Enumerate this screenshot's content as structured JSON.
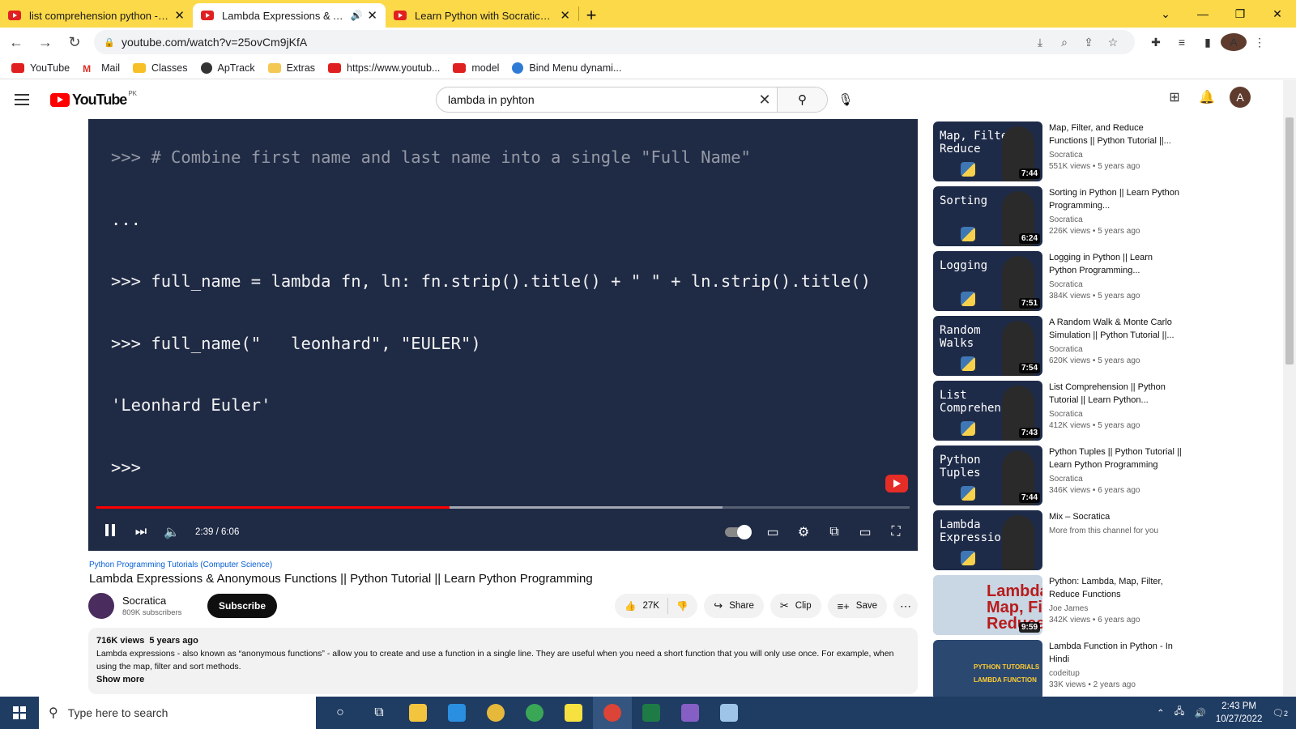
{
  "browser": {
    "tabs": [
      {
        "title": "list comprehension python - YouTube",
        "active": false
      },
      {
        "title": "Lambda Expressions & Anonymous Functions",
        "active": true,
        "audio": true
      },
      {
        "title": "Learn Python with Socratica || Python",
        "active": false
      }
    ],
    "url": "youtube.com/watch?v=25ovCm9jKfA",
    "bookmarks": [
      "YouTube",
      "Mail",
      "Classes",
      "ApTrack",
      "Extras",
      "https://www.youtub...",
      "model",
      "Bind Menu dynami..."
    ],
    "profile_initial": "A"
  },
  "youtube": {
    "logo_text": "YouTube",
    "country": "PK",
    "search_value": "lambda in pyhton",
    "avatar_initial": "A"
  },
  "player": {
    "code_lines": [
      ">>> # Combine first name and last name into a single \"Full Name\"",
      "...",
      ">>> full_name = lambda fn, ln: fn.strip().title() + \" \" + ln.strip().title()",
      ">>> full_name(\"   leonhard\", \"EULER\")",
      "'Leonhard Euler'",
      ">>>"
    ],
    "time": "2:39 / 6:06",
    "played_fraction": 0.434,
    "buffered_fraction": 0.77
  },
  "video": {
    "category": "Python Programming Tutorials (Computer Science)",
    "title": "Lambda Expressions & Anonymous Functions || Python Tutorial || Learn Python Programming",
    "channel": "Socratica",
    "subscribers": "809K subscribers",
    "subscribe_label": "Subscribe",
    "likes": "27K",
    "share_label": "Share",
    "clip_label": "Clip",
    "save_label": "Save",
    "views": "716K views",
    "age": "5 years ago",
    "description": "Lambda expressions - also known as “anonymous functions” - allow you to create and use a function in a single line.  They are useful when you need a short function that you will only use once.  For example, when using the map, filter and sort methods.",
    "show_more": "Show more"
  },
  "sidebar": [
    {
      "thumb_text": "Map, Filter,\nReduce",
      "duration": "7:44",
      "title": "Map, Filter, and Reduce Functions || Python Tutorial ||...",
      "channel": "Socratica",
      "meta": "551K views • 5 years ago"
    },
    {
      "thumb_text": "Sorting",
      "duration": "6:24",
      "title": "Sorting in Python || Learn Python Programming...",
      "channel": "Socratica",
      "meta": "226K views • 5 years ago"
    },
    {
      "thumb_text": "Logging",
      "duration": "7:51",
      "title": "Logging in Python || Learn Python Programming...",
      "channel": "Socratica",
      "meta": "384K views • 5 years ago"
    },
    {
      "thumb_text": "Random\nWalks",
      "duration": "7:54",
      "title": "A Random Walk & Monte Carlo Simulation || Python Tutorial ||...",
      "channel": "Socratica",
      "meta": "620K views • 5 years ago"
    },
    {
      "thumb_text": "List\nComprehension",
      "duration": "7:43",
      "title": "List Comprehension || Python Tutorial || Learn Python...",
      "channel": "Socratica",
      "meta": "412K views • 5 years ago"
    },
    {
      "thumb_text": "Python\nTuples",
      "duration": "7:44",
      "title": "Python Tuples || Python Tutorial || Learn Python Programming",
      "channel": "Socratica",
      "meta": "346K views • 6 years ago"
    },
    {
      "thumb_text": "Lambda\nExpressions",
      "duration": "",
      "title": "Mix – Socratica",
      "channel": "More from this channel for you",
      "meta": ""
    },
    {
      "thumb_text": "Lambda\nMap, Filter\nReduce",
      "duration": "9:59",
      "title": "Python: Lambda, Map, Filter, Reduce Functions",
      "channel": "Joe James",
      "meta": "342K views • 6 years ago"
    },
    {
      "thumb_text": "PYTHON TUTORIALS\nLAMBDA FUNCTION",
      "duration": "",
      "title": "Lambda Function in Python - In Hindi",
      "channel": "codeitup",
      "meta": "33K views • 2 years ago"
    }
  ],
  "taskbar": {
    "search_placeholder": "Type here to search",
    "time": "2:43 PM",
    "date": "10/27/2022",
    "notifications": "2"
  }
}
